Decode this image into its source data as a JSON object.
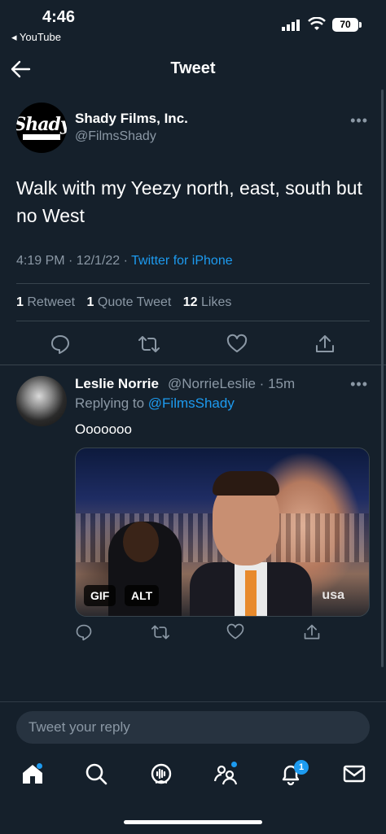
{
  "status_bar": {
    "time": "4:46",
    "back_app": "◂ YouTube",
    "battery": "70"
  },
  "header": {
    "title": "Tweet"
  },
  "tweet": {
    "author_name": "Shady Films, Inc.",
    "author_handle": "@FilmsShady",
    "avatar_text": "Shady",
    "text": "Walk with my Yeezy north, east, south but no West",
    "time_date": "4:19 PM · 12/1/22 · ",
    "source": "Twitter for iPhone",
    "stats": {
      "retweets_count": "1",
      "retweets_label": "Retweet",
      "quotes_count": "1",
      "quotes_label": "Quote Tweet",
      "likes_count": "12",
      "likes_label": "Likes"
    }
  },
  "reply": {
    "author_name": "Leslie Norrie",
    "author_handle": "@NorrieLeslie · 15m",
    "replying_prefix": "Replying to ",
    "replying_to": "@FilmsShady",
    "text": "Ooooooo",
    "media_badges": {
      "gif": "GIF",
      "alt": "ALT"
    },
    "media_watermark": "usa"
  },
  "compose": {
    "placeholder": "Tweet your reply"
  },
  "tabbar": {
    "notifications_count": "1"
  },
  "colors": {
    "background": "#15202b",
    "accent": "#1d9bf0",
    "muted": "#8b98a5"
  }
}
